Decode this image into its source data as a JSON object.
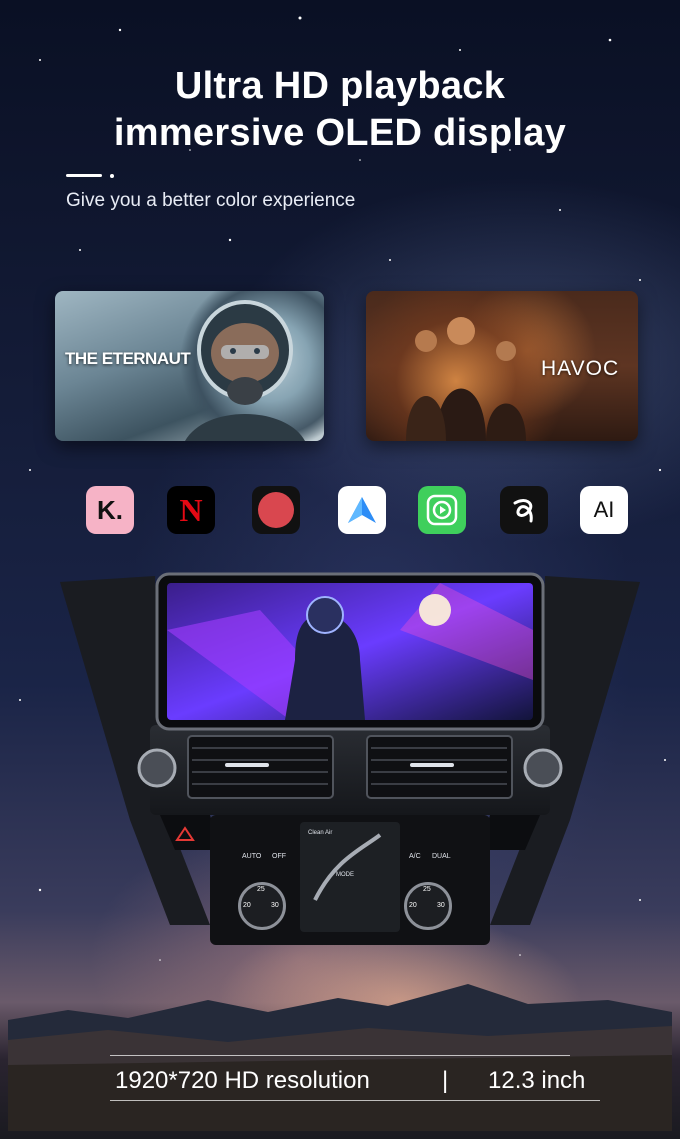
{
  "headline": {
    "line1": "Ultra HD playback",
    "line2": "immersive OLED display"
  },
  "subtitle": "Give you a better color experience",
  "posters": [
    {
      "title": "THE ETERNAUT"
    },
    {
      "title": "HAVOC"
    }
  ],
  "apps": [
    {
      "icon": "kinopoisk-icon",
      "glyph": "K.",
      "color": "#f6b3c6"
    },
    {
      "icon": "netflix-icon",
      "glyph": "N",
      "color": "#000000"
    },
    {
      "icon": "record-icon",
      "glyph": "",
      "color": "#111111"
    },
    {
      "icon": "android-auto-icon",
      "glyph": "",
      "color": "#ffffff"
    },
    {
      "icon": "carplay-icon",
      "glyph": "",
      "color": "#3fcf5c"
    },
    {
      "icon": "app-swirl-icon",
      "glyph": "",
      "color": "#111111"
    },
    {
      "icon": "ai-icon",
      "glyph": "AI",
      "color": "#ffffff"
    }
  ],
  "climate_panel": {
    "auto_label": "AUTO",
    "off_label": "OFF",
    "ac_label": "A/C",
    "dual_label": "DUAL",
    "mode_label": "MODE",
    "clean_air_label": "Clean Air",
    "left_dial": {
      "top": "25",
      "left": "20",
      "right": "30"
    },
    "right_dial": {
      "top": "25",
      "left": "20",
      "right": "30"
    }
  },
  "specs": {
    "resolution": "1920*720 HD resolution",
    "separator": "|",
    "size": "12.3 inch"
  },
  "colors": {
    "sky_top": "#0a1024",
    "accent_screen": "#6a3cff",
    "text": "#ffffff"
  }
}
